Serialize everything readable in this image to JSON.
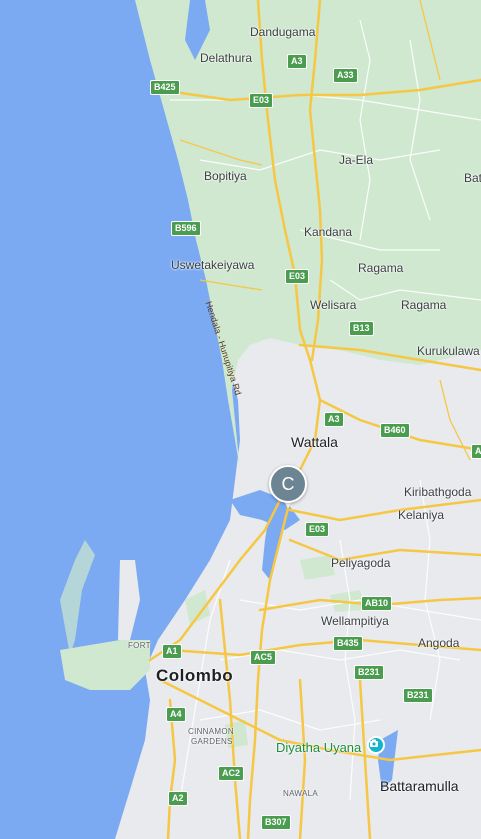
{
  "map": {
    "colors": {
      "water": "#7baaf2",
      "land": "#e8eaed",
      "green": "#c8e6c9",
      "road_major": "#fbc02d",
      "road_minor": "#ffffff",
      "shield": "#4a9d4f",
      "marker": "#6d8492"
    },
    "places": {
      "dandugama": "Dandugama",
      "delathura": "Delathura",
      "bopitiya": "Bopitiya",
      "ja_ela": "Ja-Ela",
      "bat": "Bat",
      "kandana": "Kandana",
      "uswetakeiyawa": "Uswetakeiyawa",
      "ragama_1": "Ragama",
      "welisara": "Welisara",
      "ragama_2": "Ragama",
      "kurukulawa": "Kurukulawa",
      "wattala": "Wattala",
      "kiribathgoda": "Kiribathgoda",
      "kelaniya": "Kelaniya",
      "peliyagoda": "Peliyagoda",
      "wellampitiya": "Wellampitiya",
      "angoda": "Angoda",
      "fort": "FORT",
      "colombo": "Colombo",
      "cinnamon_gardens_1": "CINNAMON",
      "cinnamon_gardens_2": "GARDENS",
      "nawala": "NAWALA",
      "battaramulla": "Battaramulla",
      "diyatha_uyana": "Diyatha Uyana"
    },
    "road_names": {
      "hendala": "Hendala - Hunupitiya Rd"
    },
    "shields": {
      "a3_top": "A3",
      "a33": "A33",
      "b425": "B425",
      "e03_top": "E03",
      "b596": "B596",
      "e03_mid": "E03",
      "b13": "B13",
      "a3_mid": "A3",
      "b460": "B460",
      "a_edge": "A",
      "e03_low": "E03",
      "ab10": "AB10",
      "b435": "B435",
      "a1": "A1",
      "ac5": "AC5",
      "b231_1": "B231",
      "b231_2": "B231",
      "a4": "A4",
      "ac2": "AC2",
      "a2": "A2",
      "b307": "B307"
    },
    "marker": {
      "label": "C"
    },
    "icons": {
      "marker": "place-marker-icon",
      "poi": "park-poi-icon"
    }
  }
}
